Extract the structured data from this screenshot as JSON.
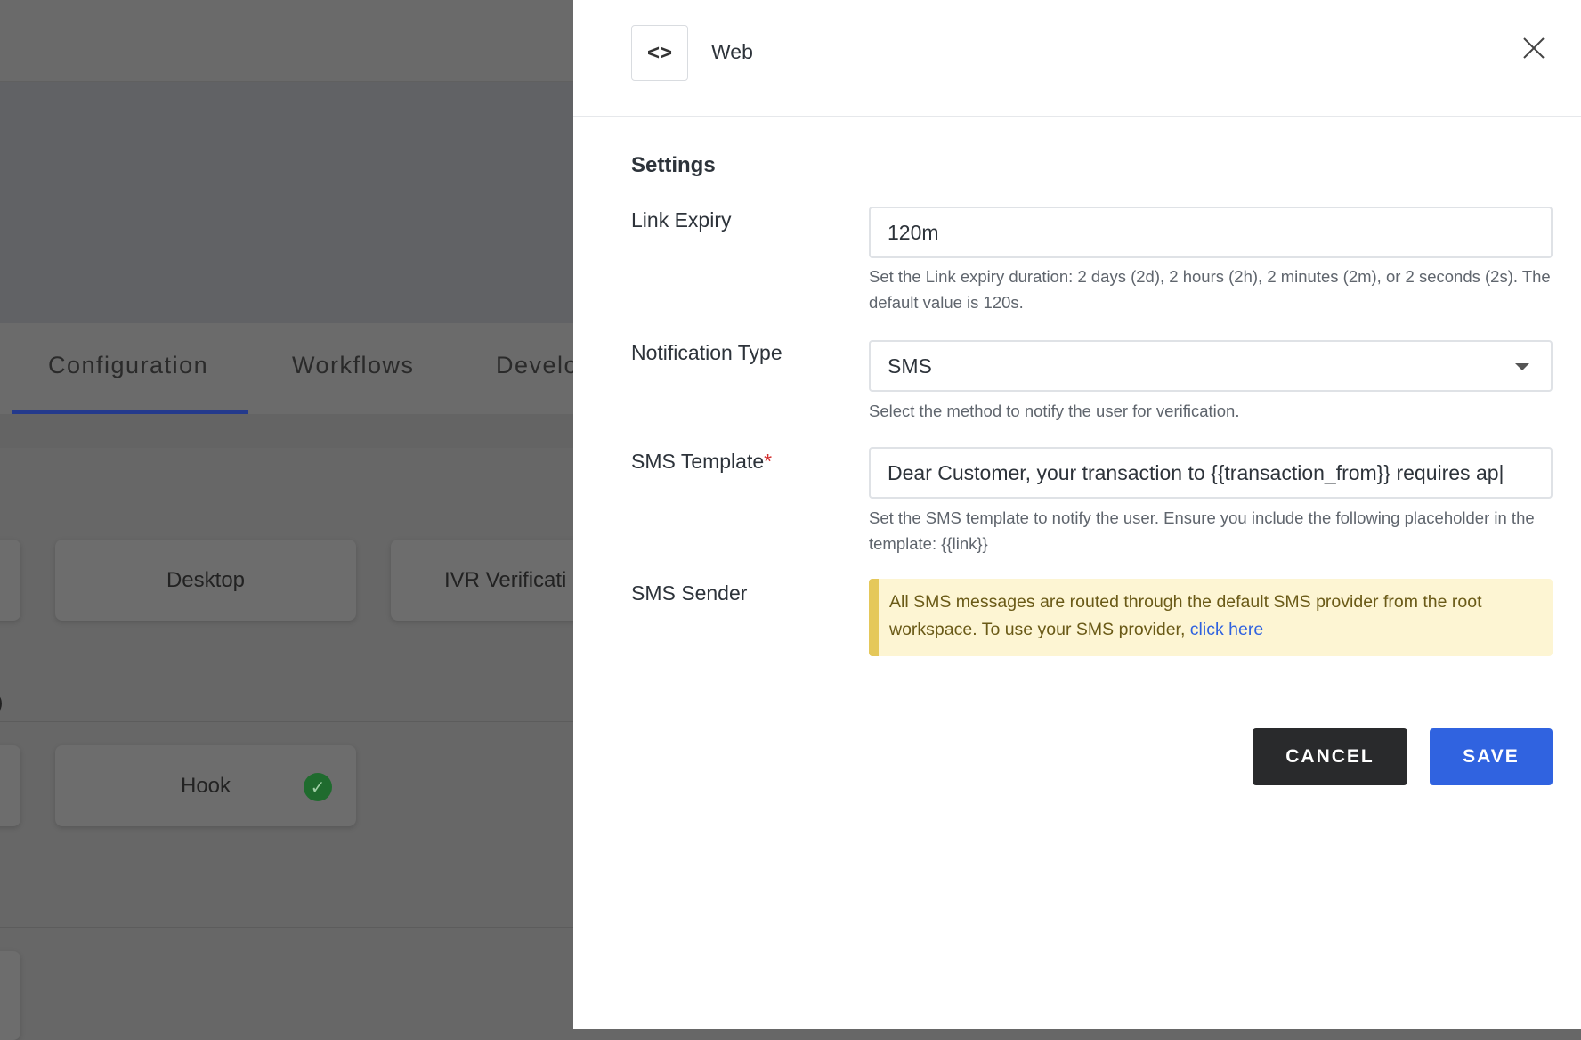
{
  "background": {
    "tabs": [
      "Configuration",
      "Workflows",
      "Develo"
    ],
    "active_tab": "Configuration",
    "cards": {
      "desktop": "Desktop",
      "ivr": "IVR Verificati",
      "hook": "Hook"
    },
    "partial_text": ")"
  },
  "panel": {
    "title": "Web",
    "icon": "code-icon",
    "icon_glyph": "<>",
    "section_title": "Settings",
    "fields": {
      "link_expiry": {
        "label": "Link Expiry",
        "value": "120m",
        "help": "Set the Link expiry duration: 2 days (2d), 2 hours (2h), 2 minutes (2m), or 2 seconds (2s). The default value is 120s."
      },
      "notification_type": {
        "label": "Notification Type",
        "value": "SMS",
        "help": "Select the method to notify the user for verification."
      },
      "sms_template": {
        "label": "SMS Template",
        "required_mark": "*",
        "value": "Dear Customer, your transaction to {{transaction_from}} requires ap|",
        "help": "Set the SMS template to notify the user. Ensure you include the following placeholder in the template: {{link}}"
      },
      "sms_sender": {
        "label": "SMS Sender",
        "alert_text": "All SMS messages are routed through the default SMS provider from the root workspace. To use your SMS provider, ",
        "alert_link": "click here"
      }
    },
    "cancel_label": "CANCEL",
    "save_label": "SAVE"
  },
  "colors": {
    "primary": "#3063e0",
    "dark_button": "#292a2c",
    "alert_bg": "#fdf5d3",
    "alert_border": "#e5c85a",
    "tab_underline": "#243a8c",
    "success": "#1f6b2e"
  }
}
